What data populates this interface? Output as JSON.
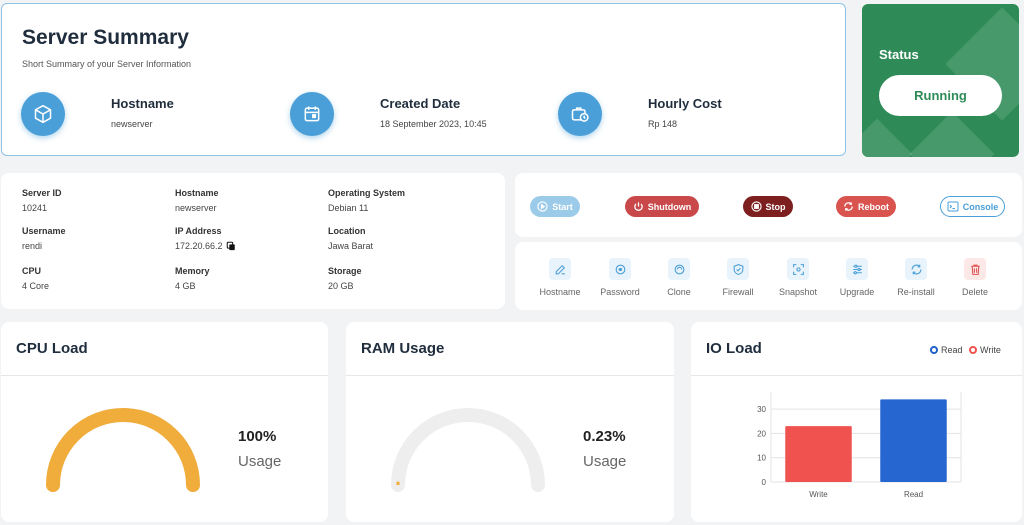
{
  "summary": {
    "title": "Server Summary",
    "subtitle": "Short Summary of your Server Information",
    "items": [
      {
        "label": "Hostname",
        "value": "newserver",
        "icon": "cube-icon"
      },
      {
        "label": "Created Date",
        "value": "18 September 2023, 10:45",
        "icon": "calendar-icon"
      },
      {
        "label": "Hourly Cost",
        "value": "Rp 148",
        "icon": "cost-clock-icon"
      }
    ]
  },
  "status": {
    "label": "Status",
    "value": "Running",
    "color": "#2e8b57"
  },
  "info": {
    "server_id": {
      "label": "Server ID",
      "value": "10241"
    },
    "hostname": {
      "label": "Hostname",
      "value": "newserver"
    },
    "os": {
      "label": "Operating System",
      "value": "Debian 11"
    },
    "username": {
      "label": "Username",
      "value": "rendi"
    },
    "ip": {
      "label": "IP Address",
      "value": "172.20.66.2"
    },
    "location": {
      "label": "Location",
      "value": "Jawa Barat"
    },
    "cpu": {
      "label": "CPU",
      "value": "4 Core"
    },
    "memory": {
      "label": "Memory",
      "value": "4 GB"
    },
    "storage": {
      "label": "Storage",
      "value": "20 GB"
    }
  },
  "power": {
    "start": {
      "label": "Start",
      "color": "#9ccbe9"
    },
    "shutdown": {
      "label": "Shutdown",
      "color": "#c9494a"
    },
    "stop": {
      "label": "Stop",
      "color": "#7d1f1f"
    },
    "reboot": {
      "label": "Reboot",
      "color": "#d9534f"
    },
    "console": {
      "label": "Console",
      "color": "#4a9fd8"
    }
  },
  "actions": [
    {
      "label": "Hostname",
      "icon": "edit-icon"
    },
    {
      "label": "Password",
      "icon": "key-icon"
    },
    {
      "label": "Clone",
      "icon": "clone-icon"
    },
    {
      "label": "Firewall",
      "icon": "shield-icon"
    },
    {
      "label": "Snapshot",
      "icon": "snapshot-icon"
    },
    {
      "label": "Upgrade",
      "icon": "sliders-icon"
    },
    {
      "label": "Re-install",
      "icon": "reinstall-icon"
    },
    {
      "label": "Delete",
      "icon": "trash-icon"
    }
  ],
  "cpu_load": {
    "title": "CPU Load",
    "value": "100%",
    "caption": "Usage",
    "percent": 100,
    "color": "#f0ad3c"
  },
  "ram_usage": {
    "title": "RAM Usage",
    "value": "0.23%",
    "caption": "Usage",
    "percent": 0.23,
    "color": "#f0ad3c"
  },
  "io_load": {
    "title": "IO Load",
    "legend": [
      {
        "name": "Read",
        "color": "#1e62c9"
      },
      {
        "name": "Write",
        "color": "#f0524f"
      }
    ]
  },
  "chart_data": {
    "type": "bar",
    "categories": [
      "Write",
      "Read"
    ],
    "values": [
      23,
      34
    ],
    "colors": [
      "#f0524f",
      "#2566d0"
    ],
    "yticks": [
      0,
      10,
      20,
      30
    ],
    "ylim": [
      0,
      35
    ],
    "title": "",
    "xlabel": "",
    "ylabel": "",
    "grid": true
  }
}
